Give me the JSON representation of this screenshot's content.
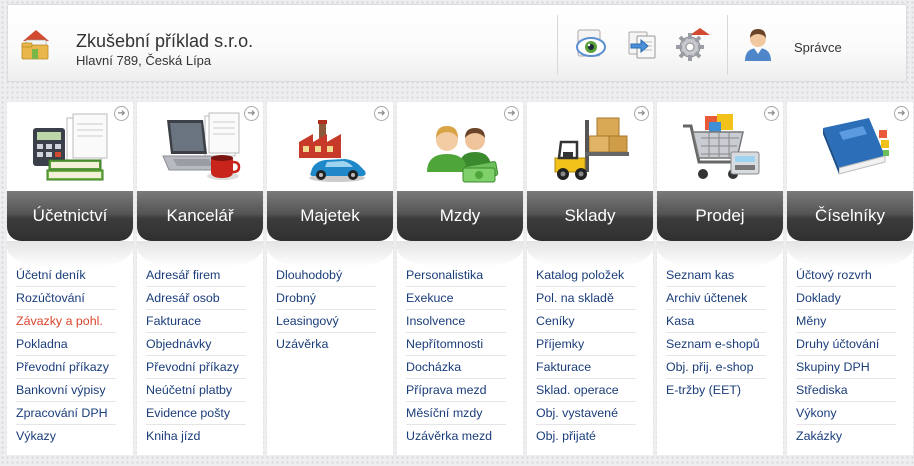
{
  "header": {
    "company_name": "Zkušební příklad s.r.o.",
    "company_address": "Hlavní 789, Česká Lípa",
    "user_name": "Správce",
    "icons": [
      "eye-icon",
      "transfer-icon",
      "settings-icon",
      "user-icon"
    ]
  },
  "colors": {
    "link": "#1a3d7a",
    "link_highlight": "#d9442b",
    "title_bar": "#3c3c3c"
  },
  "modules": [
    {
      "title": "Účetnictví",
      "icon": "accounting-icon",
      "links": [
        "Účetní deník",
        "Rozúčtování",
        "Závazky a pohl.",
        "Pokladna",
        "Převodní příkazy",
        "Bankovní výpisy",
        "Zpracování DPH",
        "Výkazy"
      ],
      "highlight": 2
    },
    {
      "title": "Kancelář",
      "icon": "office-icon",
      "links": [
        "Adresář firem",
        "Adresář osob",
        "Fakturace",
        "Objednávky",
        "Převodní příkazy",
        "Neúčetní platby",
        "Evidence pošty",
        "Kniha jízd"
      ]
    },
    {
      "title": "Majetek",
      "icon": "property-icon",
      "links": [
        "Dlouhodobý",
        "Drobný",
        "Leasingový",
        "Uzávěrka"
      ]
    },
    {
      "title": "Mzdy",
      "icon": "payroll-icon",
      "links": [
        "Personalistika",
        "Exekuce",
        "Insolvence",
        "Nepřítomnosti",
        "Docházka",
        "Příprava mezd",
        "Měsíční mzdy",
        "Uzávěrka mezd"
      ]
    },
    {
      "title": "Sklady",
      "icon": "warehouse-icon",
      "links": [
        "Katalog položek",
        "Pol. na skladě",
        "Ceníky",
        "Příjemky",
        "Fakturace",
        "Sklad. operace",
        "Obj. vystavené",
        "Obj. přijaté"
      ]
    },
    {
      "title": "Prodej",
      "icon": "sales-icon",
      "links": [
        "Seznam kas",
        "Archiv účtenek",
        "Kasa",
        "Seznam e-shopů",
        "Obj. přij. e-shop",
        "E-tržby (EET)"
      ]
    },
    {
      "title": "Číselníky",
      "icon": "codebook-icon",
      "links": [
        "Účtový rozvrh",
        "Doklady",
        "Měny",
        "Druhy účtování",
        "Skupiny DPH",
        "Střediska",
        "Výkony",
        "Zakázky"
      ]
    }
  ]
}
